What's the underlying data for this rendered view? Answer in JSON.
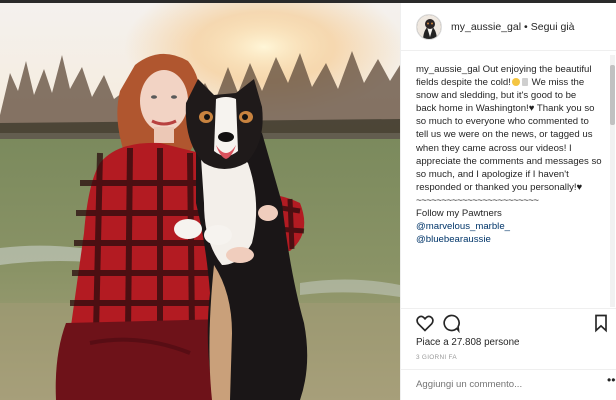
{
  "header": {
    "username": "my_aussie_gal",
    "separator": "•",
    "follow_label": "Segui già"
  },
  "caption": {
    "username": "my_aussie_gal",
    "lines": [
      "Out enjoying the beautiful",
      "fields despite the cold!",
      "We miss the",
      "snow and sledding, but it's good to be",
      "back home in Washington!",
      "Thank you so",
      "so much to everyone who commented to",
      "tell us we were on the news, or tagged us",
      "when they came across our videos! I",
      "appreciate the comments and messages so",
      "so much, and I apologize if I haven't",
      "responded or thanked you personally!",
      "~~~~~~~~~~~~~~~~~~~~~~~~",
      "Follow my Pawtners"
    ],
    "mentions": [
      "@marvelous_marble_",
      "@bluebearaussie"
    ]
  },
  "actions": {
    "like_icon": "heart-icon",
    "comment_icon": "comment-icon",
    "save_icon": "bookmark-icon"
  },
  "likes_text": "Piace a 27.808 persone",
  "time_ago": "3 GIORNI FA",
  "comment_placeholder": "Aggiungi un commento...",
  "more_label": "•••",
  "colors": {
    "text": "#262626",
    "link": "#003569",
    "muted": "#999999",
    "border": "#efefef"
  }
}
